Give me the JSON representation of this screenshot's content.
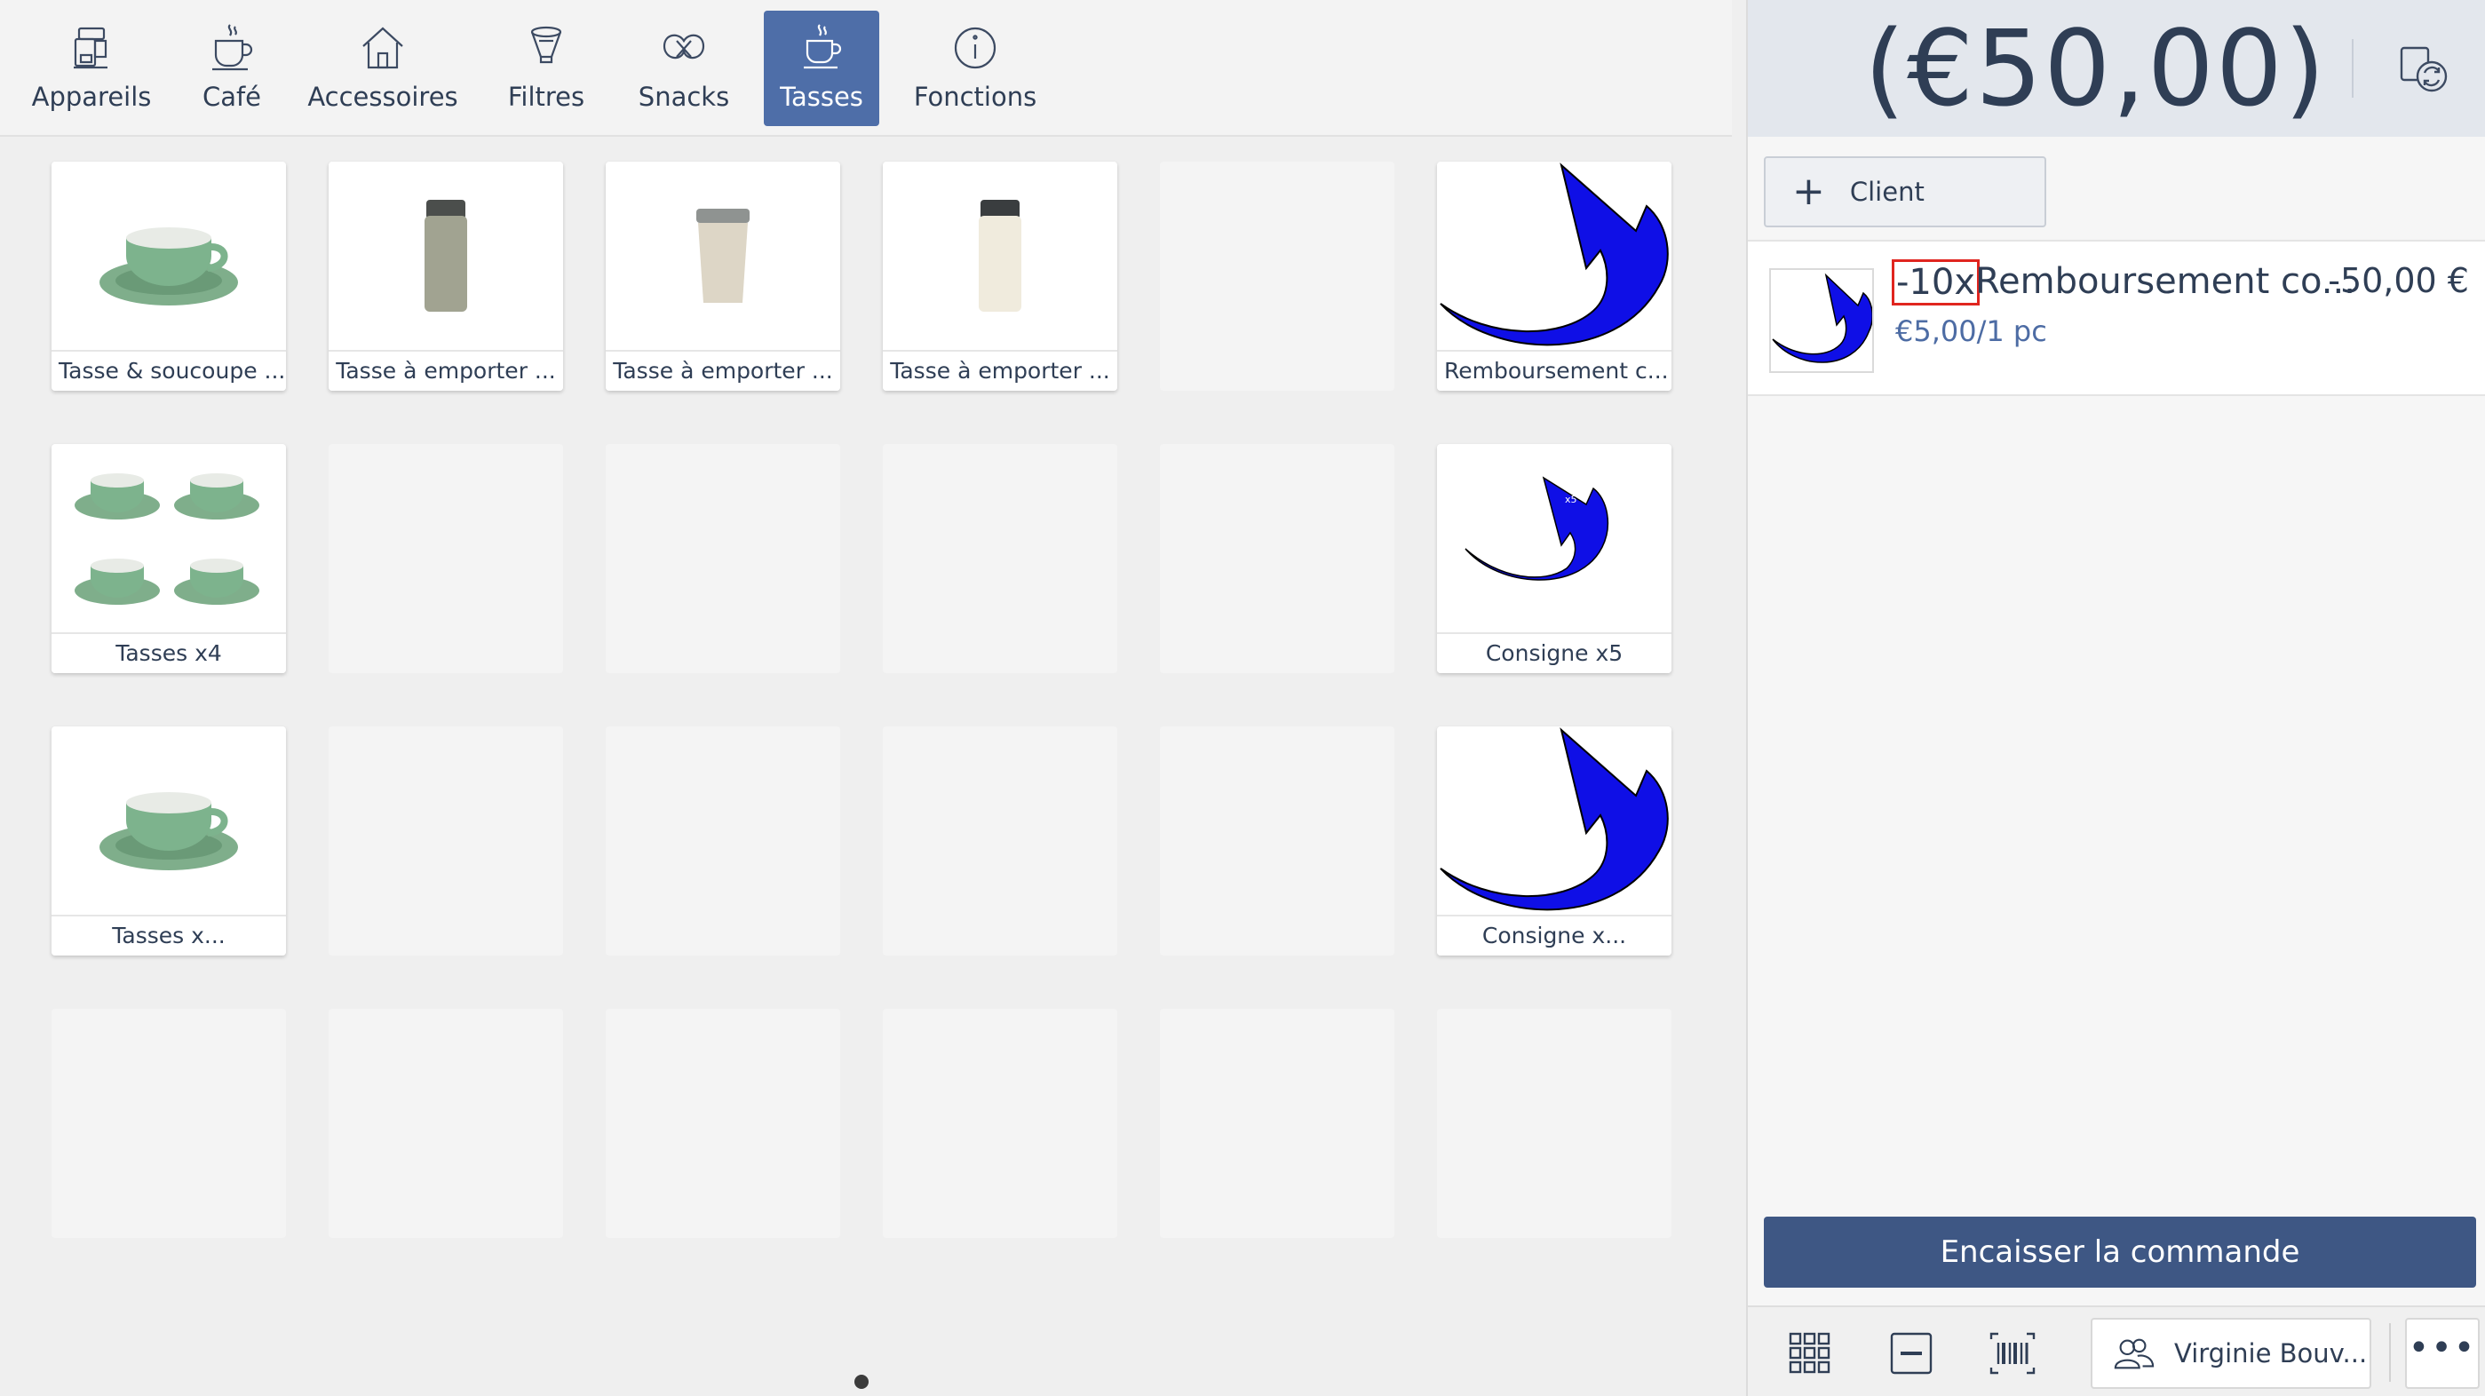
{
  "tabs": [
    {
      "label": "Appareils",
      "icon": "appliance-icon",
      "active": false
    },
    {
      "label": "Café",
      "icon": "coffee-cup-icon",
      "active": false
    },
    {
      "label": "Accessoires",
      "icon": "house-icon",
      "active": false
    },
    {
      "label": "Filtres",
      "icon": "filter-icon",
      "active": false
    },
    {
      "label": "Snacks",
      "icon": "pretzel-icon",
      "active": false
    },
    {
      "label": "Tasses",
      "icon": "cup-icon",
      "active": true
    },
    {
      "label": "Fonctions",
      "icon": "info-icon",
      "active": false
    }
  ],
  "products": [
    {
      "label": "Tasse & soucoupe ...",
      "image": "green-cup-saucer"
    },
    {
      "label": "Tasse à emporter ...",
      "image": "khaki-tumbler"
    },
    {
      "label": "Tasse à emporter ...",
      "image": "beige-tumbler"
    },
    {
      "label": "Tasse à emporter ...",
      "image": "white-tumbler"
    },
    {
      "label": "Remboursement c...",
      "image": "blue-return-arrow"
    },
    {
      "label": "Tasses x4",
      "image": "four-green-cups"
    },
    {
      "label": "Consigne x5",
      "image": "blue-return-arrow-x5",
      "arrow_badge": "x5"
    },
    {
      "label": "Tasses x...",
      "image": "green-cup-saucer"
    },
    {
      "label": "Consigne x...",
      "image": "blue-return-arrow"
    }
  ],
  "total": "(€50,00)",
  "client_button": "Client",
  "order_line": {
    "quantity": "-10x",
    "name": "Remboursement co...",
    "price": "-50,00 €",
    "unit_price": "€5,00/1 pc"
  },
  "checkout_label": "Encaisser la commande",
  "user_name": "Virginie Bouv...",
  "more_label": "•••",
  "colors": {
    "accent": "#4e6ea8",
    "checkout": "#3e5784",
    "highlight": "#e0251f",
    "arrow": "#1010e8"
  }
}
